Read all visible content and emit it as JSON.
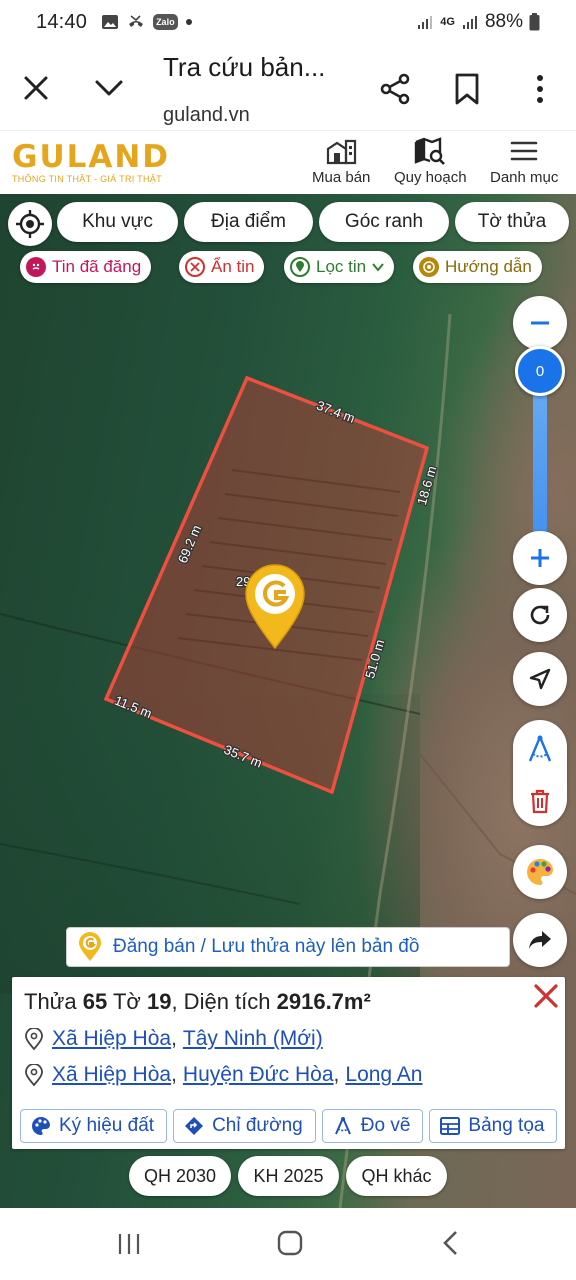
{
  "status_bar": {
    "time": "14:40",
    "network": "4G",
    "battery": "88%"
  },
  "browser": {
    "title": "Tra cứu bản...",
    "url": "guland.vn"
  },
  "site": {
    "logo_word": "GULAND",
    "logo_tagline": "THÔNG TIN THẬT - GIÁ TRỊ THẬT",
    "nav": [
      "Mua bán",
      "Quy hoạch",
      "Danh mục"
    ]
  },
  "filters": {
    "chips": [
      "Khu vực",
      "Địa điểm",
      "Góc ranh",
      "Tờ thửa"
    ],
    "secondary": [
      {
        "label": "Tin đã đăng",
        "color": "#c2185b"
      },
      {
        "label": "Ẩn tin",
        "color": "#d32f2f"
      },
      {
        "label": "Lọc tin",
        "color": "#2e7d32"
      },
      {
        "label": "Hướng dẫn",
        "color": "#b8860b"
      }
    ]
  },
  "map": {
    "zoom_level": "0",
    "parcel_edges": [
      "37.4 m",
      "18.6 m",
      "51.0 m",
      "35.7 m",
      "11.5 m",
      "69.2 m"
    ],
    "parcel_label_partial": "29"
  },
  "banner": {
    "text": "Đăng bán / Lưu thửa này lên bản đồ"
  },
  "parcel": {
    "label_thua": "Thửa",
    "thua": "65",
    "label_to": "Tờ",
    "to": "19",
    "label_area": ", Diện tích",
    "area": "2916.7m²",
    "new_admin": {
      "commune": "Xã Hiệp Hòa",
      "province": "Tây Ninh (Mới)"
    },
    "old_admin": {
      "commune": "Xã Hiệp Hòa",
      "district": "Huyện Đức Hòa",
      "province": "Long An"
    },
    "actions": [
      "Ký hiệu đất",
      "Chỉ đường",
      "Đo vẽ",
      "Bảng tọa"
    ]
  },
  "plan_pills": [
    "QH 2030",
    "KH 2025",
    "QH khác"
  ],
  "colors": {
    "brand": "#e5a51c",
    "link": "#1f4fb8",
    "parcel_border": "#ef4f3f",
    "zoom": "#1a73e8",
    "close": "#d32f2f"
  }
}
